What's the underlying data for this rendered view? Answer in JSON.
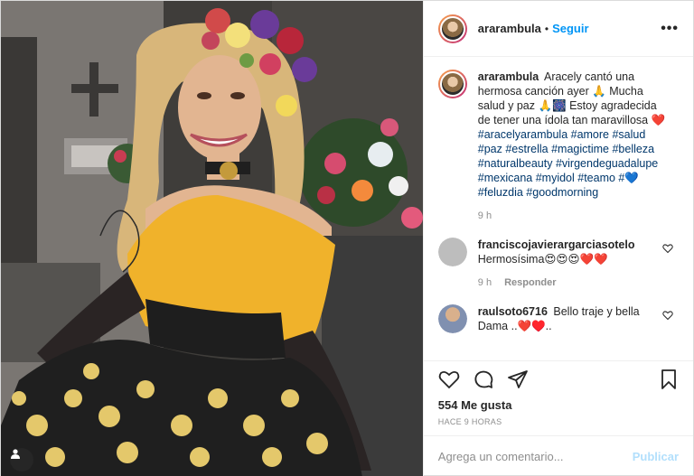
{
  "post": {
    "author": "ararambula",
    "follow_label": "Seguir",
    "more_icon": "•••",
    "separator": "•"
  },
  "caption": {
    "user": "ararambula",
    "text": "Aracely cantó una hermosa canción ayer 🙏 Mucha salud y paz 🙏🎆 Estoy agradecida de tener una ídola tan maravillosa ❤️",
    "hashtags": "#aracelyarambula #amore #salud #paz #estrella #magictime #belleza #naturalbeauty #virgendeguadalupe #mexicana #myidol #teamo #💙 #feluzdia #goodmorning",
    "time": "9 h"
  },
  "comments": [
    {
      "user": "franciscojavierargarciasotelo",
      "text": "Hermosísima😍😍😍❤️❤️",
      "time": "9 h",
      "reply_label": "Responder"
    },
    {
      "user": "raulsoto6716",
      "text": "Bello traje y bella Dama ..❤️♥️..",
      "time": "",
      "reply_label": ""
    }
  ],
  "stats": {
    "likes": "554 Me gusta",
    "posted": "HACE 9 HORAS"
  },
  "composer": {
    "placeholder": "Agrega un comentario...",
    "publish_label": "Publicar"
  },
  "colors": {
    "accent": "#0095f6",
    "hashtag": "#00376b",
    "muted": "#8e8e8e",
    "publish_disabled": "#b2dffc"
  },
  "icons": [
    "heart-icon",
    "comment-icon",
    "share-icon",
    "bookmark-icon",
    "more-icon",
    "user-tag-icon"
  ]
}
